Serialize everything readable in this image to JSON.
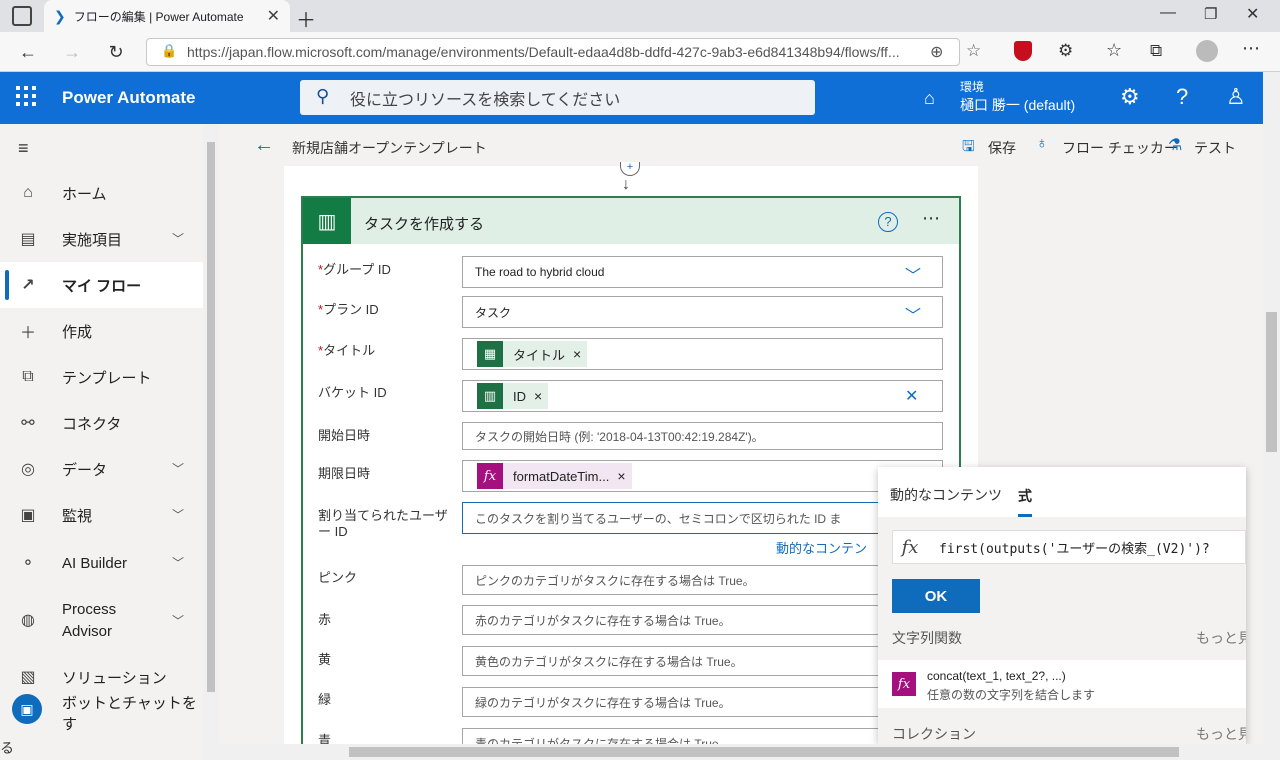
{
  "browser": {
    "tab_title": "フローの編集 | Power Automate",
    "url": "https://japan.flow.microsoft.com/manage/environments/Default-edaa4d8b-ddfd-427c-9ab3-e6d841348b94/flows/ff..."
  },
  "header": {
    "brand": "Power Automate",
    "search_placeholder": "役に立つリソースを検索してください",
    "env_label": "環境",
    "env_name": "樋口 勝一 (default)"
  },
  "sidebar": {
    "items": [
      {
        "label": "ホーム"
      },
      {
        "label": "実施項目"
      },
      {
        "label": "マイ フロー"
      },
      {
        "label": "作成"
      },
      {
        "label": "テンプレート"
      },
      {
        "label": "コネクタ"
      },
      {
        "label": "データ"
      },
      {
        "label": "監視"
      },
      {
        "label": "AI Builder"
      },
      {
        "label": "Process Advisor"
      },
      {
        "label": "ソリューション"
      },
      {
        "label": "ボットとチャットをす"
      }
    ],
    "bottom_text": "る"
  },
  "toolbar": {
    "flow_name": "新規店舗オープンテンプレート",
    "save": "保存",
    "checker": "フロー チェッカー",
    "test": "テスト"
  },
  "card": {
    "title": "タスクを作成する",
    "fields": [
      {
        "label": "グループ ID",
        "value": "The road to hybrid cloud"
      },
      {
        "label": "プラン ID",
        "value": "タスク"
      },
      {
        "label": "タイトル",
        "token": "タイトル"
      },
      {
        "label": "バケット ID",
        "token": "ID"
      },
      {
        "label": "開始日時",
        "placeholder": "タスクの開始日時 (例: '2018-04-13T00:42:19.284Z')。"
      },
      {
        "label": "期限日時",
        "token": "formatDateTim..."
      },
      {
        "label": "割り当てられたユーザー ID",
        "placeholder": "このタスクを割り当てるユーザーの、セミコロンで区切られた ID ま"
      },
      {
        "label": "ピンク",
        "placeholder": "ピンクのカテゴリがタスクに存在する場合は True。"
      },
      {
        "label": "赤",
        "placeholder": "赤のカテゴリがタスクに存在する場合は True。"
      },
      {
        "label": "黄",
        "placeholder": "黄色のカテゴリがタスクに存在する場合は True。"
      },
      {
        "label": "緑",
        "placeholder": "緑のカテゴリがタスクに存在する場合は True。"
      },
      {
        "label": "青",
        "placeholder": "青のカテゴリがタスクに存在する場合は True。"
      }
    ],
    "dynamic_link": "動的なコンテン"
  },
  "panel": {
    "tab_dynamic": "動的なコンテンツ",
    "tab_expr": "式",
    "expression": "first(outputs('ユーザーの検索_(V2)')?",
    "ok": "OK",
    "section1": "文字列関数",
    "more1": "もっと見",
    "func_name": "concat(text_1, text_2?, ...)",
    "func_desc": "任意の数の文字列を結合します",
    "section2": "コレクション",
    "more2": "もっと見"
  }
}
